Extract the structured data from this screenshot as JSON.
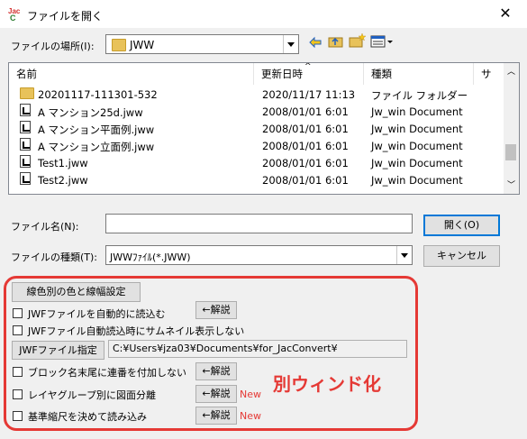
{
  "window": {
    "title": "ファイルを開く",
    "close_glyph": "✕"
  },
  "location": {
    "label": "ファイルの場所(I):",
    "value": "JWW"
  },
  "list": {
    "headers": [
      "名前",
      "更新日時",
      "種類",
      "サ"
    ],
    "rows": [
      {
        "icon": "folder",
        "name": "20201117-111301-532",
        "date": "2020/11/17 11:13",
        "type": "ファイル フォルダー"
      },
      {
        "icon": "document",
        "name": "A マンション25d.jww",
        "date": "2008/01/01 6:01",
        "type": "Jw_win Document"
      },
      {
        "icon": "document",
        "name": "A マンション平面例.jww",
        "date": "2008/01/01 6:01",
        "type": "Jw_win Document"
      },
      {
        "icon": "document",
        "name": "A マンション立面例.jww",
        "date": "2008/01/01 6:01",
        "type": "Jw_win Document"
      },
      {
        "icon": "document",
        "name": "Test1.jww",
        "date": "2008/01/01 6:01",
        "type": "Jw_win Document"
      },
      {
        "icon": "document",
        "name": "Test2.jww",
        "date": "2008/01/01 6:01",
        "type": "Jw_win Document"
      }
    ]
  },
  "filename": {
    "label": "ファイル名(N):",
    "value": ""
  },
  "filetype": {
    "label": "ファイルの種類(T):",
    "value": "JWWﾌｧｲﾙ(*.JWW)"
  },
  "buttons": {
    "open": "開く(O)",
    "cancel": "キャンセル"
  },
  "options": {
    "color_width_button": "線色別の色と線幅設定",
    "auto_jwf": "JWFファイルを自動的に読込む",
    "no_thumbnail": "JWFファイル自動読込時にサムネイル表示しない",
    "jwf_button": "JWFファイル指定",
    "jwf_path": "C:¥Users¥jza03¥Documents¥for_JacConvert¥",
    "block_seq": "ブロック名末尾に連番を付加しない",
    "layer_group": "レイヤグループ別に図面分離",
    "scale_read": "基準縮尺を決めて読み込み",
    "explain": "←解説",
    "new_badge": "New",
    "annotation": "別ウィンド化"
  },
  "colors": {
    "accent": "#0078d7",
    "annotation_red": "#e53935",
    "folder": "#e8c25a"
  }
}
